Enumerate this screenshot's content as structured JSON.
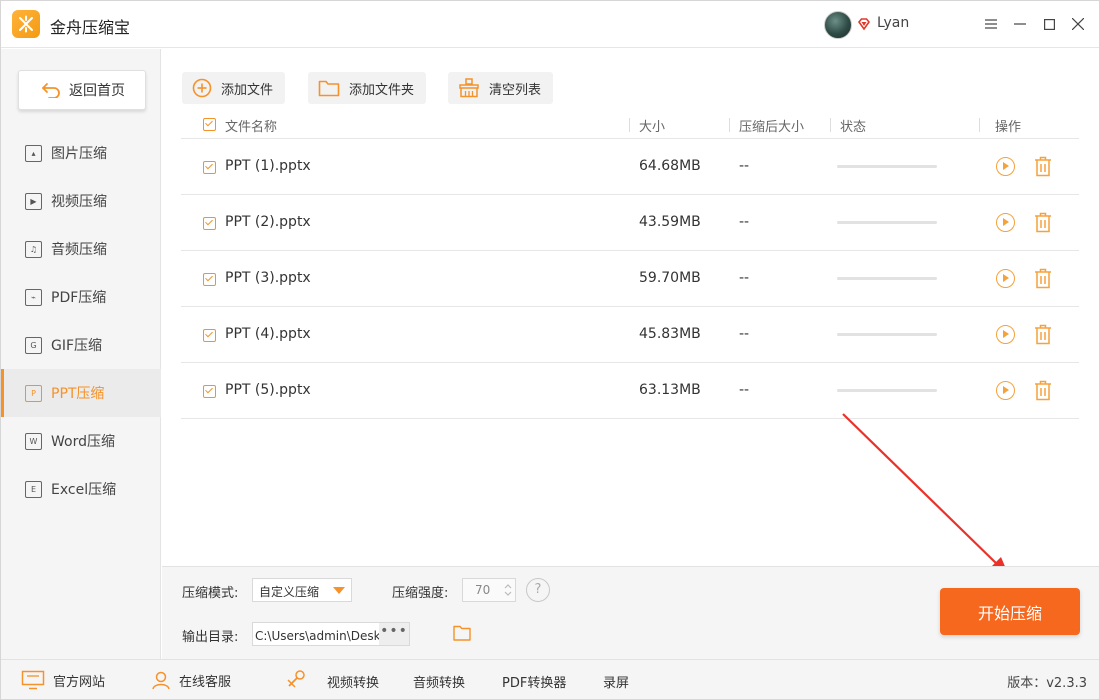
{
  "app": {
    "title": "金舟压缩宝"
  },
  "user": {
    "name": "Lyan"
  },
  "colors": {
    "accent": "#f5922a",
    "start_button": "#f7681f",
    "arrow": "#e8322a"
  },
  "sidebar": {
    "back_label": "返回首页",
    "items": [
      {
        "label": "图片压缩",
        "icon": "image-icon"
      },
      {
        "label": "视频压缩",
        "icon": "video-icon"
      },
      {
        "label": "音频压缩",
        "icon": "audio-icon"
      },
      {
        "label": "PDF压缩",
        "icon": "pdf-icon"
      },
      {
        "label": "GIF压缩",
        "icon": "gif-icon"
      },
      {
        "label": "PPT压缩",
        "icon": "ppt-icon",
        "active": true
      },
      {
        "label": "Word压缩",
        "icon": "word-icon"
      },
      {
        "label": "Excel压缩",
        "icon": "excel-icon"
      }
    ]
  },
  "toolbar": {
    "add_file": "添加文件",
    "add_folder": "添加文件夹",
    "clear_list": "清空列表"
  },
  "table": {
    "headers": {
      "name": "文件名称",
      "size": "大小",
      "compressed_size": "压缩后大小",
      "status": "状态",
      "actions": "操作"
    },
    "rows": [
      {
        "name": "PPT (1).pptx",
        "size": "64.68MB",
        "compressed_size": "--",
        "progress": 0
      },
      {
        "name": "PPT (2).pptx",
        "size": "43.59MB",
        "compressed_size": "--",
        "progress": 0
      },
      {
        "name": "PPT (3).pptx",
        "size": "59.70MB",
        "compressed_size": "--",
        "progress": 0
      },
      {
        "name": "PPT (4).pptx",
        "size": "45.83MB",
        "compressed_size": "--",
        "progress": 0
      },
      {
        "name": "PPT (5).pptx",
        "size": "63.13MB",
        "compressed_size": "--",
        "progress": 0
      }
    ]
  },
  "settings": {
    "mode_label": "压缩模式:",
    "mode_value": "自定义压缩",
    "strength_label": "压缩强度:",
    "strength_value": "70",
    "help": "?",
    "output_label": "输出目录:",
    "output_path": "C:\\Users\\admin\\Desktop\\金",
    "path_more": "•••",
    "start_label": "开始压缩"
  },
  "footer": {
    "website": "官方网站",
    "service": "在线客服",
    "video_convert": "视频转换",
    "audio_convert": "音频转换",
    "pdf_convert": "PDF转换器",
    "record": "录屏",
    "version": "版本：v2.3.3"
  }
}
